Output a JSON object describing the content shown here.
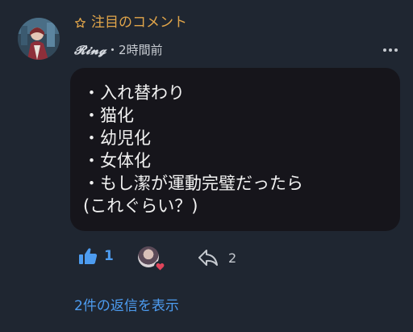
{
  "featured": {
    "label": "注目のコメント",
    "icon": "star-outline-icon",
    "color": "#e1a54a"
  },
  "author": {
    "name": "𝓡𝓲𝓷𝓰",
    "time": "・2時間前"
  },
  "comment": {
    "lines": [
      "・入れ替わり",
      "・猫化",
      "・幼児化",
      "・女体化",
      "・もし潔が運動完璧だったら",
      "(これぐらい？)"
    ]
  },
  "actions": {
    "like_count": "1",
    "share_count": "2"
  },
  "replies": {
    "label": "2件の返信を表示"
  },
  "colors": {
    "background": "#1f2631",
    "bubble": "#16151b",
    "accent_blue": "#4d9cf0",
    "heart": "#e0445a"
  }
}
